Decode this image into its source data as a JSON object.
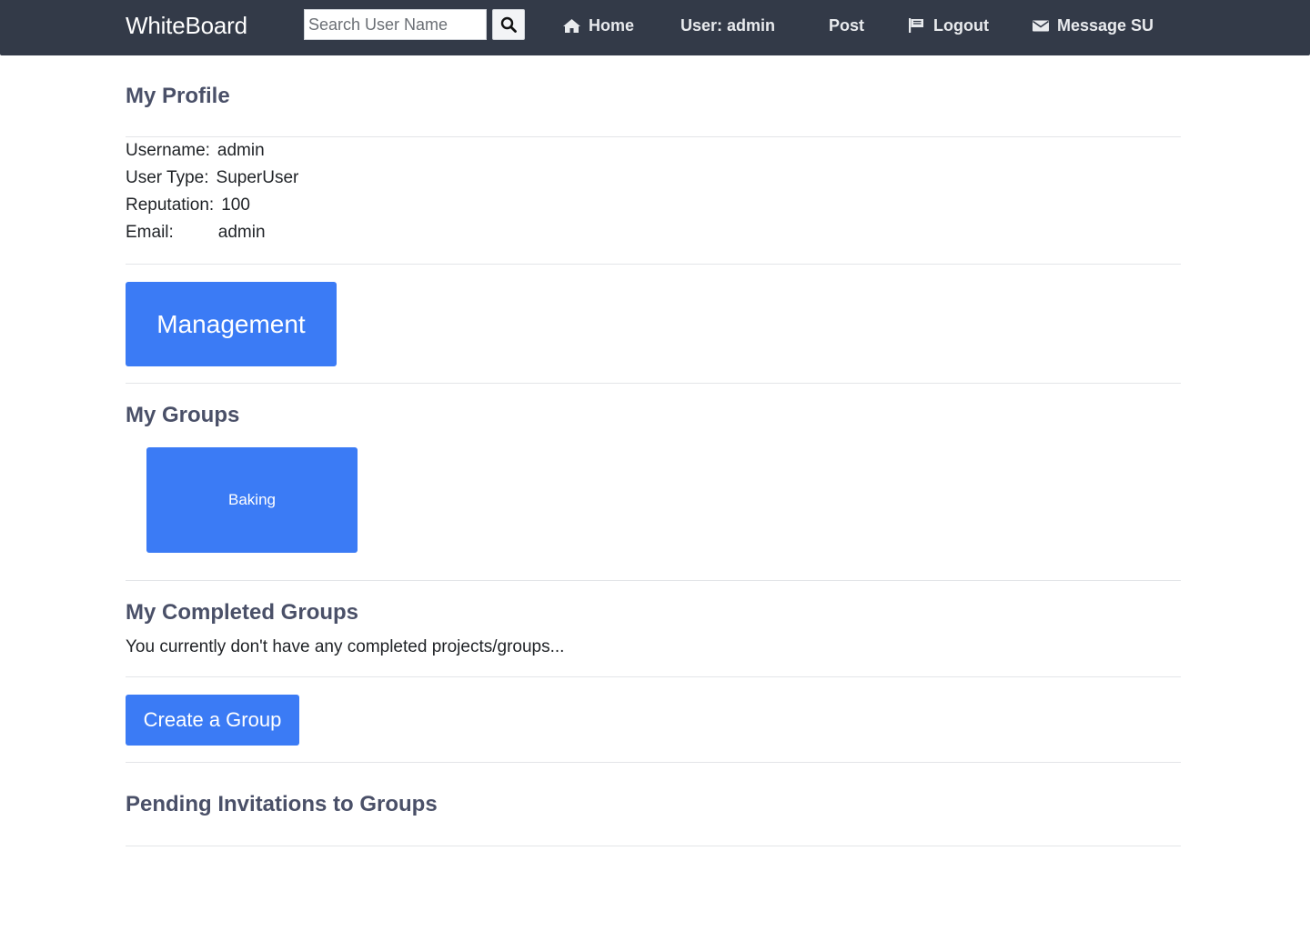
{
  "navbar": {
    "brand": "WhiteBoard",
    "search": {
      "placeholder": "Search User Name",
      "value": ""
    },
    "items": [
      {
        "label": "Home",
        "icon": "home-icon"
      },
      {
        "label": "User: admin",
        "icon": ""
      },
      {
        "label": "Post",
        "icon": ""
      },
      {
        "label": "Logout",
        "icon": "flag-icon"
      },
      {
        "label": "Message SU",
        "icon": "envelope-icon"
      }
    ]
  },
  "profile": {
    "title": "My Profile",
    "fields": [
      {
        "label": "Username:",
        "value": "admin"
      },
      {
        "label": "User Type:",
        "value": "SuperUser"
      },
      {
        "label": "Reputation:",
        "value": "100"
      },
      {
        "label": "Email:",
        "value": "admin"
      }
    ]
  },
  "management": {
    "label": "Management"
  },
  "groups": {
    "title": "My Groups",
    "items": [
      {
        "name": "Baking"
      }
    ]
  },
  "completed_groups": {
    "title": "My Completed Groups",
    "empty_message": "You currently don't have any completed projects/groups..."
  },
  "create_group": {
    "label": "Create a Group"
  },
  "pending_invitations": {
    "title": "Pending Invitations to Groups"
  },
  "colors": {
    "navbar_bg": "#333a48",
    "accent": "#3b7bf5",
    "heading": "#4a5068"
  }
}
